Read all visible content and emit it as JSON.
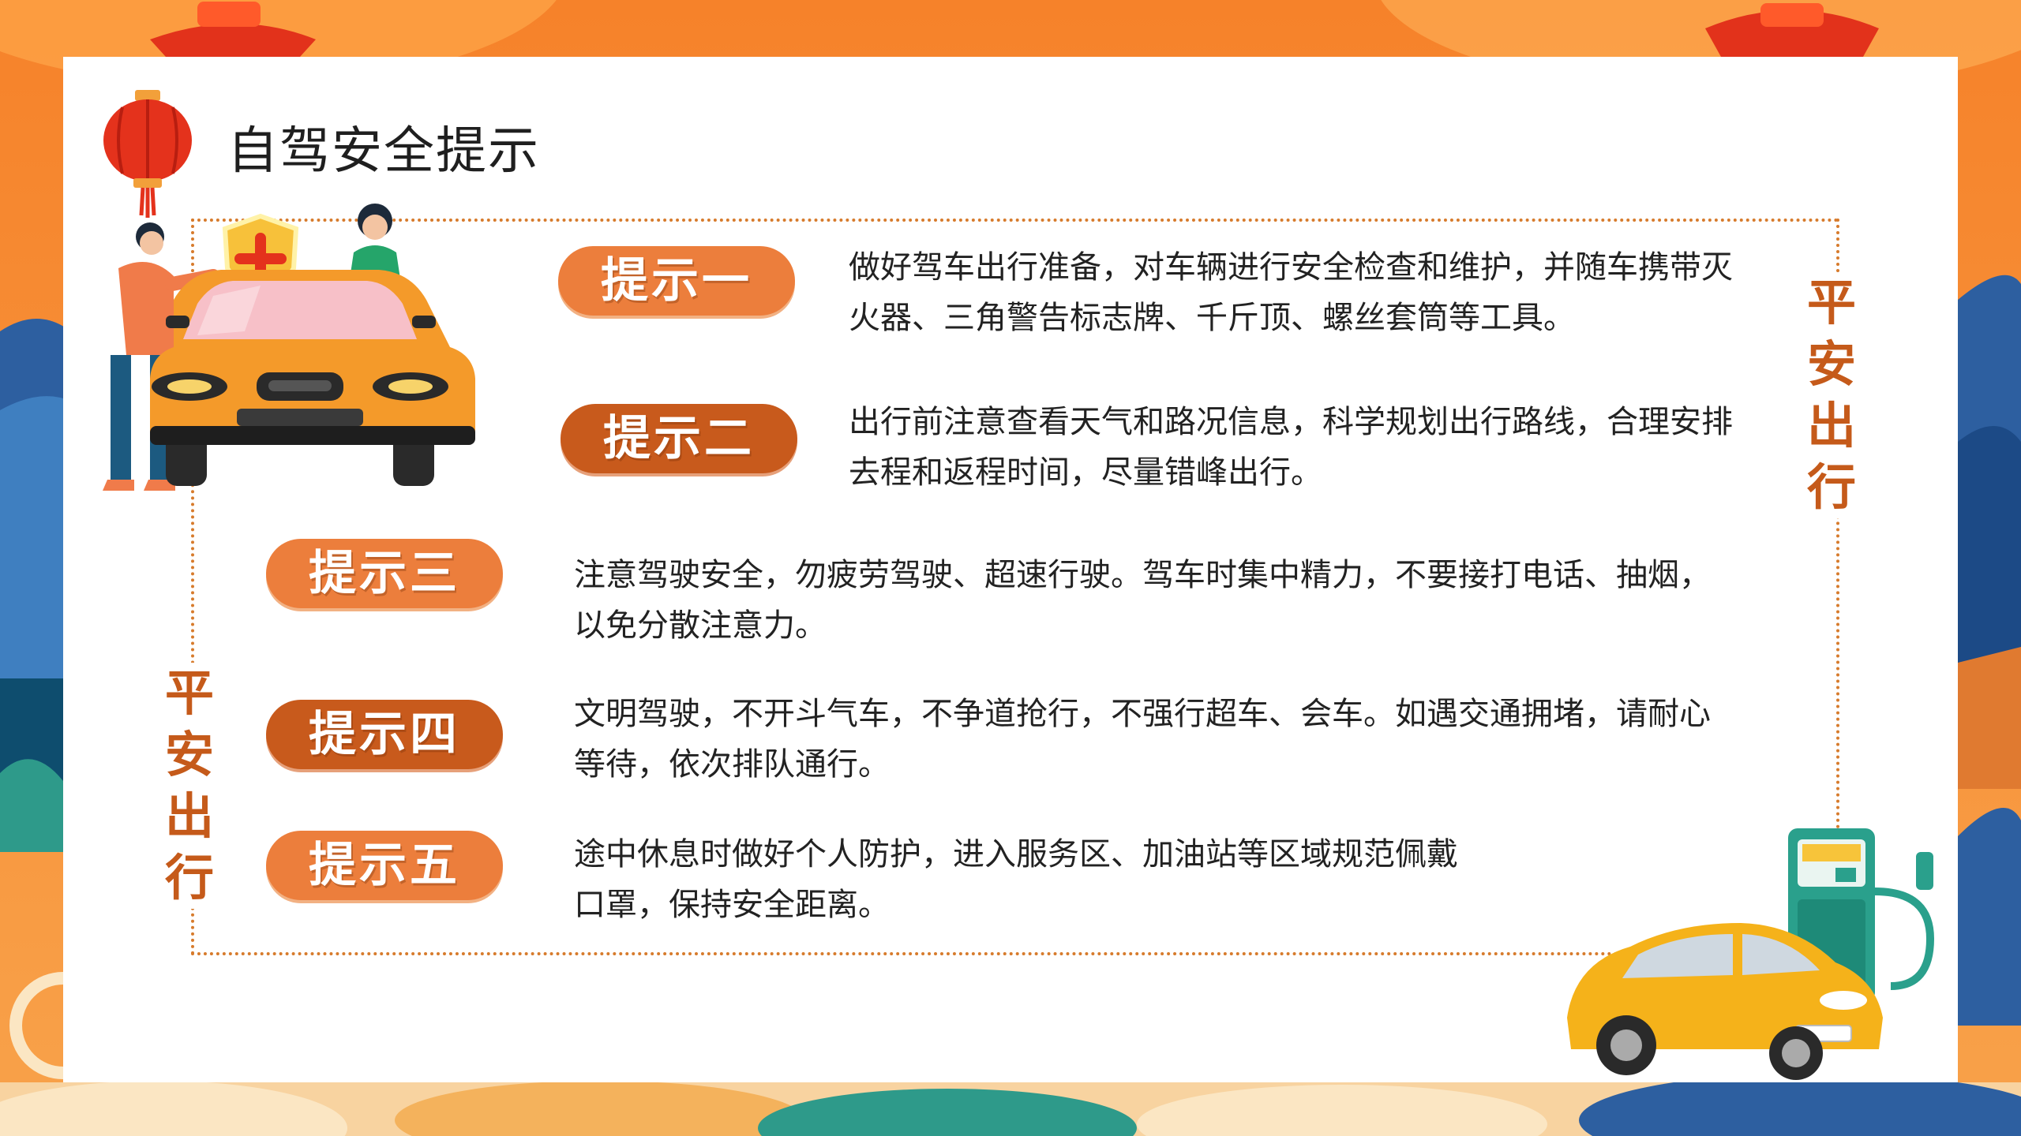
{
  "slide": {
    "title": "自驾安全提示",
    "vertical_label_right": [
      "平",
      "安",
      "出",
      "行"
    ],
    "vertical_label_left": [
      "平",
      "安",
      "出",
      "行"
    ],
    "tips": [
      {
        "label": "提示一",
        "text": "做好驾车出行准备，对车辆进行安全检查和维护，并随车携带灭火器、三角警告标志牌、千斤顶、螺丝套筒等工具。"
      },
      {
        "label": "提示二",
        "text": "出行前注意查看天气和路况信息，科学规划出行路线，合理安排去程和返程时间，尽量错峰出行。"
      },
      {
        "label": "提示三",
        "text": "注意驾驶安全，勿疲劳驾驶、超速行驶。驾车时集中精力，不要接打电话、抽烟，以免分散注意力。"
      },
      {
        "label": "提示四",
        "text": "文明驾驶，不开斗气车，不争道抢行，不强行超车、会车。如遇交通拥堵，请耐心等待，依次排队通行。"
      },
      {
        "label": "提示五",
        "text_line1": "途中休息时做好个人防护，进入服务区、加油站等区域规范佩戴",
        "text_line2": "口罩，保持安全距离。"
      }
    ]
  },
  "icons": {
    "lantern": "lantern-icon",
    "car_people": "car-with-people-illustration",
    "shield": "shield-cross-icon",
    "gas_pump": "gas-pump-icon",
    "yellow_car": "yellow-car-illustration"
  },
  "colors": {
    "background_orange": "#f58a2e",
    "accent_dark": "#c85a1c",
    "accent_light": "#ec7e3c",
    "frame_dotted": "#d77b2c",
    "mountain_blue": "#2d5fa0",
    "teal": "#2e9a8a"
  }
}
